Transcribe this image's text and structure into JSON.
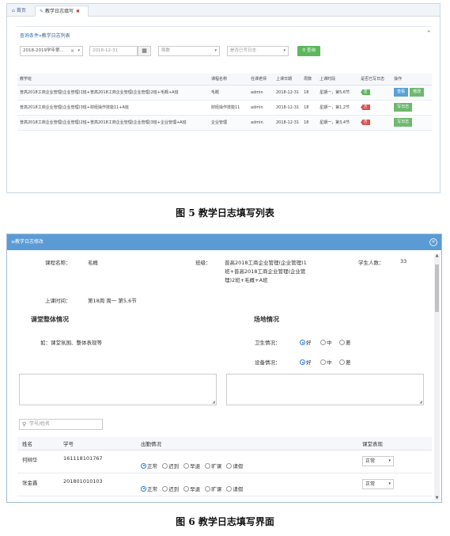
{
  "fig5": {
    "tabs": [
      {
        "label": "首页",
        "active": false
      },
      {
        "label": "教学日志填写",
        "active": true
      }
    ],
    "panel_title_prefix": "查询条件",
    "panel_title_suffix": "»教学日志列表",
    "filters": {
      "semester": "2018-2019学年第...",
      "date": "2018-12-31",
      "weekday_placeholder": "周数",
      "filled_placeholder": "是否已写日志",
      "query_label": "查询"
    },
    "table": {
      "headers": [
        "教学班",
        "课程名称",
        "任课老师",
        "上课日期",
        "周数",
        "上课时段",
        "是否已写日志",
        "操作"
      ],
      "rows": [
        {
          "class": "普高2018工商企业管理(企业管理)1班+普高2018工商企业管理(企业管理)2班+毛概+A班",
          "course": "毛概",
          "teacher": "admin",
          "date": "2018-12-31",
          "week": "18",
          "period": "星期一，第5,6节",
          "status": "是",
          "status_kind": "yes",
          "actions": [
            "查看",
            "修改"
          ]
        },
        {
          "class": "普高2018工商企业管理(企业管理)3班+财经操作技能11+A班",
          "course": "财经操作技能11",
          "teacher": "admin",
          "date": "2018-12-31",
          "week": "18",
          "period": "星期一，第1,2节",
          "status": "否",
          "status_kind": "no",
          "actions": [
            "写日志"
          ]
        },
        {
          "class": "普高2018工商企业管理(企业管理)2班+普高2018工商企业管理(企业管理)3班+企业管理+A班",
          "course": "企业管理",
          "teacher": "admin",
          "date": "2018-12-31",
          "week": "18",
          "period": "星期一，第3,4节",
          "status": "否",
          "status_kind": "no",
          "actions": [
            "写日志"
          ]
        }
      ]
    }
  },
  "caption5": "图 5  教学日志填写列表",
  "fig6": {
    "title": "教学日志修改",
    "course_label": "课程名称：",
    "course_value": "毛概",
    "class_label": "班级：",
    "class_lines": [
      "普高2018工商企业管理(企业管理)1",
      "班+普高2018工商企业管理(企业管",
      "理)2班+毛概+A班"
    ],
    "students_label": "学生人数：",
    "students_value": "33",
    "time_label": "上课时间：",
    "time_value": "第18周  周一  第5,6节",
    "overall_heading": "课堂整体情况",
    "overall_hint": "如：课堂氛围、整体表现等",
    "site_heading": "场地情况",
    "hygiene_label": "卫生情况：",
    "equipment_label": "设备情况：",
    "ratings": [
      "好",
      "中",
      "差"
    ],
    "search_placeholder": "学号/姓名",
    "table": {
      "headers": [
        "姓名",
        "学号",
        "出勤情况",
        "课堂表现"
      ],
      "attendance_options": [
        "正常",
        "迟到",
        "早退",
        "旷课",
        "请假"
      ],
      "rows": [
        {
          "name": "何柳华",
          "id": "161118101767",
          "perf": "正常"
        },
        {
          "name": "张金鑫",
          "id": "201801010103",
          "perf": "正常"
        }
      ]
    }
  },
  "caption6": "图 6  教学日志填写界面",
  "colors": {
    "dialog_header": "#5b9bd5",
    "query_button": "#5cb85c",
    "tag_yes": "#5cb85c",
    "tag_no": "#d9534f",
    "view_button": "#5aa0d8",
    "edit_button": "#6fb86f"
  }
}
